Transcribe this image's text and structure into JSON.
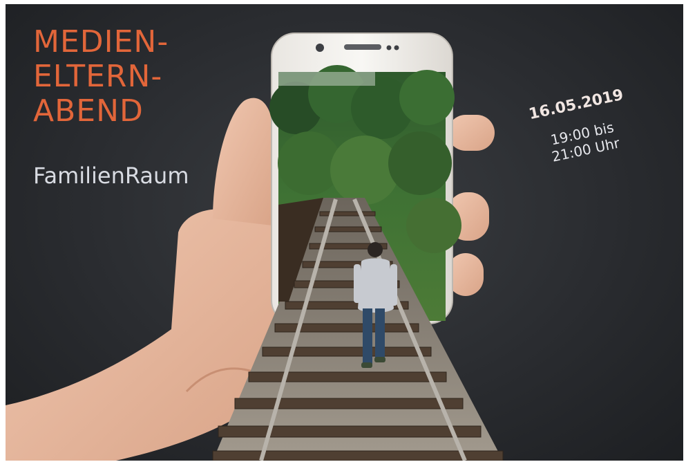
{
  "poster": {
    "title_lines": [
      "MEDIEN-",
      "ELTERN-",
      "ABEND"
    ],
    "subtitle": "FamilienRaum",
    "date": "16.05.2019",
    "time_line_1": "19:00 bis",
    "time_line_2": "21:00 Uhr"
  },
  "colors": {
    "title": "#e2663a",
    "subtitle": "#d8dbe2",
    "background": "#2a2c30"
  },
  "illustration": {
    "subject": "hand holding smartphone with railway track and walking person emerging from screen",
    "icons": [
      "hand-icon",
      "smartphone-icon",
      "railway-track-icon",
      "person-icon",
      "forest-icon"
    ]
  }
}
